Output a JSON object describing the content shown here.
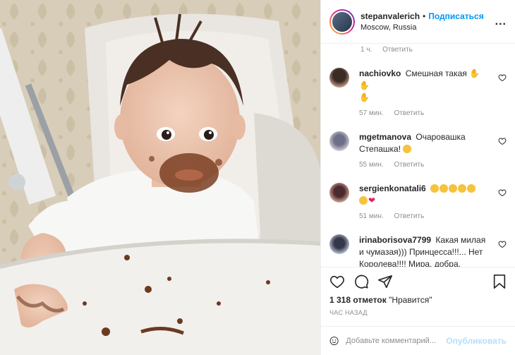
{
  "header": {
    "username": "stepanvalerich",
    "separator": "•",
    "follow_label": "Подписаться",
    "location": "Moscow, Russia",
    "more_label": "..."
  },
  "caption_meta": {
    "time": "1 ч.",
    "reply": "Ответить"
  },
  "comments": [
    {
      "user": "nachiovko",
      "text": "Смешная такая",
      "emoji": [
        "thumbs-up",
        "thumbs-up",
        "thumbs-up"
      ],
      "time": "57 мин.",
      "reply": "Ответить"
    },
    {
      "user": "mgetmanova",
      "text": "Очаровашка Степашка!",
      "emoji": [
        "heart-eyes"
      ],
      "time": "55 мин.",
      "reply": "Ответить"
    },
    {
      "user": "sergienkonatali6",
      "text": "",
      "emoji": [
        "heart-eyes",
        "heart-eyes",
        "heart-eyes",
        "heart-eyes",
        "heart-eyes",
        "heart-eyes",
        "red-heart"
      ],
      "time": "51 мин.",
      "reply": "Ответить"
    },
    {
      "user": "irinaborisova7799",
      "text": "Какая милая и чумазая))) Принцесса!!!... Нет Королева!!!! Мира, добра, счастья Вам!",
      "emoji": [],
      "time": "",
      "reply": ""
    }
  ],
  "likes": {
    "count": "1 318 отметок",
    "label": "\"Нравится\""
  },
  "timestamp": "ЧАС НАЗАД",
  "add_comment": {
    "placeholder": "Добавьте комментарий...",
    "publish_label": "Опубликовать"
  },
  "colors": {
    "accent": "#0095f6",
    "publish_disabled": "#b2dffc",
    "meta": "#8e8e8e"
  }
}
